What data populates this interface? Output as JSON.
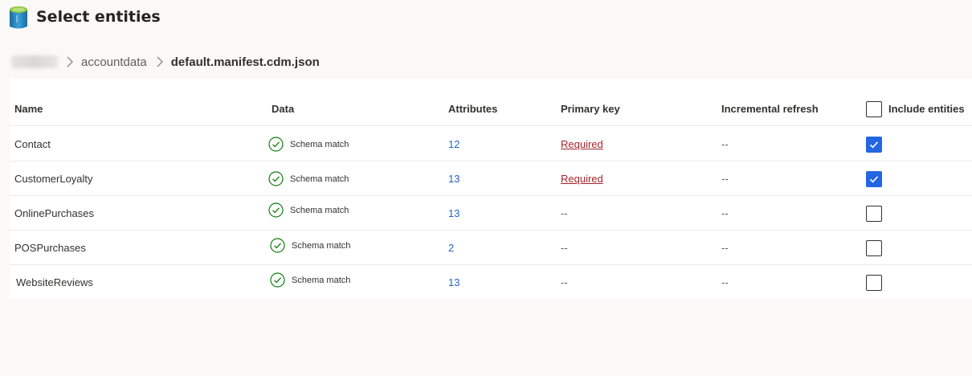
{
  "header": {
    "title": "Select entities"
  },
  "breadcrumb": {
    "items": [
      "accountdata"
    ],
    "current": "default.manifest.cdm.json"
  },
  "table": {
    "columns": {
      "name": "Name",
      "data": "Data",
      "attributes": "Attributes",
      "primary_key": "Primary key",
      "incremental_refresh": "Incremental refresh",
      "include_entities": "Include entities"
    },
    "rows": [
      {
        "name": "Contact",
        "data": "Schema match",
        "attributes": "12",
        "primary_key": "Required",
        "incremental_refresh": "--",
        "included": true
      },
      {
        "name": "CustomerLoyalty",
        "data": "Schema match",
        "attributes": "13",
        "primary_key": "Required",
        "incremental_refresh": "--",
        "included": true
      },
      {
        "name": "OnlinePurchases",
        "data": "Schema match",
        "attributes": "13",
        "primary_key": "--",
        "incremental_refresh": "--",
        "included": false
      },
      {
        "name": "POSPurchases",
        "data": "Schema match",
        "attributes": "2",
        "primary_key": "--",
        "incremental_refresh": "--",
        "included": false
      },
      {
        "name": "WebsiteReviews",
        "data": "Schema match",
        "attributes": "13",
        "primary_key": "--",
        "incremental_refresh": "--",
        "included": false
      }
    ]
  },
  "colors": {
    "accent": "#2266e3",
    "link": "#2266c9",
    "required": "#a4262c",
    "success": "#107c10"
  },
  "icons": [
    "database-icon",
    "chevron-right-icon",
    "check-circle-icon",
    "checkmark-icon"
  ]
}
